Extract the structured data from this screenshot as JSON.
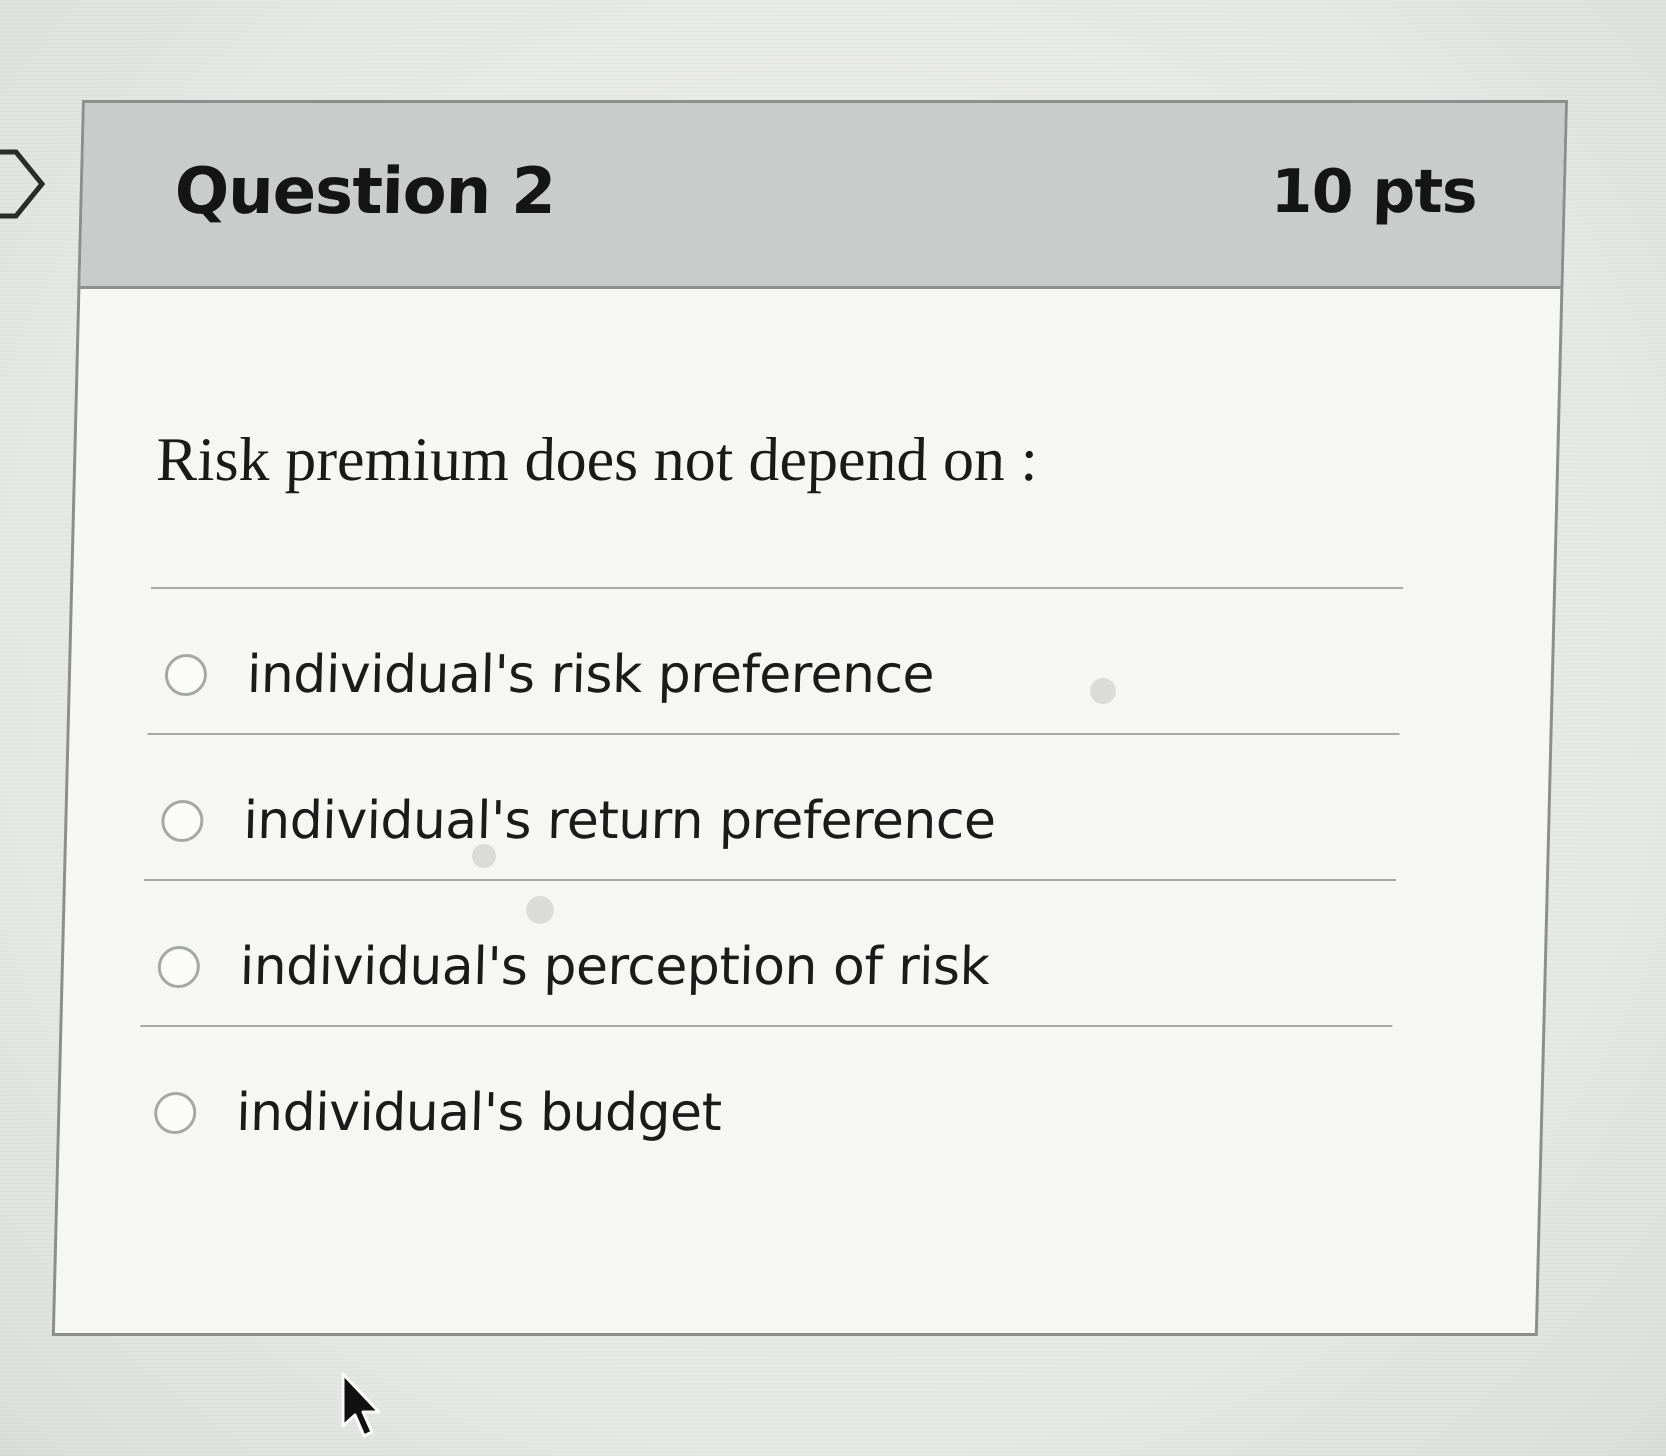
{
  "question": {
    "title": "Question 2",
    "points": "10 pts",
    "prompt": "Risk premium does not depend on :"
  },
  "answers": [
    {
      "label": "individual's risk preference",
      "selected": false
    },
    {
      "label": "individual's return preference",
      "selected": false
    },
    {
      "label": "individual's perception of risk",
      "selected": false
    },
    {
      "label": "individual's budget",
      "selected": false
    }
  ],
  "icons": {
    "nav": "previous-chevron-icon",
    "cursor": "mouse-pointer-icon",
    "answer_control": "radio-button"
  },
  "colors": {
    "header_background": "#c9ccca",
    "card_background": "#f6f7f5",
    "border": "#8c8f8d",
    "text": "#151515"
  }
}
